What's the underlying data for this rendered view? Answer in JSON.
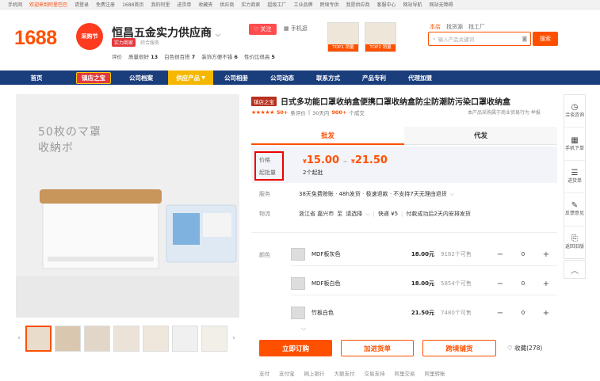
{
  "topbar": {
    "items": [
      "手机网",
      "欢迎来到阿里巴巴",
      "请登录",
      "免费注册",
      "1688首页",
      "我的阿里",
      "进货单",
      "收藏夹",
      "供应商",
      "实力商家",
      "超级工厂",
      "工业品牌",
      "跨境专供",
      "我是供应商",
      "客服中心",
      "网站导航",
      "网站无障碍"
    ]
  },
  "header": {
    "logo": "1688",
    "festival_label": "采购节",
    "shop_name": "恒昌五金实力供应商",
    "shop_badge": "实力商家",
    "shop_service": "综合服务",
    "ratings": [
      {
        "label": "评价",
        "value": ""
      },
      {
        "label": "质量很好",
        "value": "13"
      },
      {
        "label": "白色很百搭",
        "value": "7"
      },
      {
        "label": "装饰方便不错",
        "value": "6"
      },
      {
        "label": "性价比很高",
        "value": "5"
      }
    ],
    "follow_label": "关注",
    "phone_label": "手机逛",
    "awards": [
      "TOP1 销量",
      "TOP2 销量"
    ],
    "search_tabs": [
      "本店",
      "找货源",
      "找工厂"
    ],
    "search_placeholder": "输入产品关键词",
    "search_button": "搜索"
  },
  "nav": {
    "items": [
      "首页",
      "镇店之宝",
      "公司档案",
      "供应产品",
      "公司相册",
      "公司动态",
      "联系方式",
      "产品专利",
      "代理加盟"
    ]
  },
  "gallery": {
    "image_text_1": "50枚のマ罩",
    "image_text_2": "收納ボ",
    "thumb_count": 8
  },
  "product": {
    "store_tag": "镇店之宝",
    "title": "日式多功能口罩收纳盒便携口罩收纳盒防尘防潮防污染口罩收纳盒",
    "rating_stars": "★★★★★",
    "review_count": "50+",
    "review_label": "条评价",
    "sales_period": "30天内",
    "sales_count": "900+",
    "sales_label": "个成交",
    "report_links": "本产品采购属于商业贸易行为    举报",
    "tabs": [
      "批发",
      "代发"
    ],
    "price_label": "价格",
    "moq_label": "起批量",
    "price_low": "15.00",
    "price_high": "21.50",
    "price_symbol": "¥",
    "price_dash": "~",
    "moq_value": "2个起批",
    "service_label": "服务",
    "service_value": "38天免费赊账 · 48h发货 · 极速退款 · 不支持7天无理由退货",
    "logistics_label": "物流",
    "logistics_origin": "浙江省 嘉兴市",
    "logistics_to": "至",
    "logistics_dest": "请选择",
    "logistics_fee": "快递 ¥5",
    "logistics_note": "付款成功后2天内安排发货",
    "color_label": "颜色",
    "variants": [
      {
        "name": "MDF板灰色",
        "price": "18.00元",
        "stock": "9182个可售",
        "qty": "0"
      },
      {
        "name": "MDF板白色",
        "price": "18.00元",
        "stock": "5854个可售",
        "qty": "0"
      },
      {
        "name": "竹板白色",
        "price": "21.50元",
        "stock": "7480个可售",
        "qty": "0"
      }
    ],
    "buy_now": "立即订购",
    "add_cart": "加进货单",
    "cross_border": "跨境铺货",
    "favorite_label": "收藏",
    "favorite_count": "(278)",
    "bottom_items": [
      "支付",
      "支付宝",
      "网上银行",
      "大额支付",
      "交易支持",
      "阿里交易",
      "阿里转账"
    ]
  },
  "sidebar": {
    "items": [
      {
        "icon": "clock-icon",
        "label": "洽谈咨询"
      },
      {
        "icon": "qr-icon",
        "label": "手机下单"
      },
      {
        "icon": "list-icon",
        "label": "进货单"
      },
      {
        "icon": "edit-icon",
        "label": "反馈意见"
      },
      {
        "icon": "back-icon",
        "label": "返回旧版"
      }
    ]
  },
  "colors": {
    "brand": "#ff5000",
    "nav_bg": "#1a3d7c",
    "highlight_box": "#e00000"
  }
}
